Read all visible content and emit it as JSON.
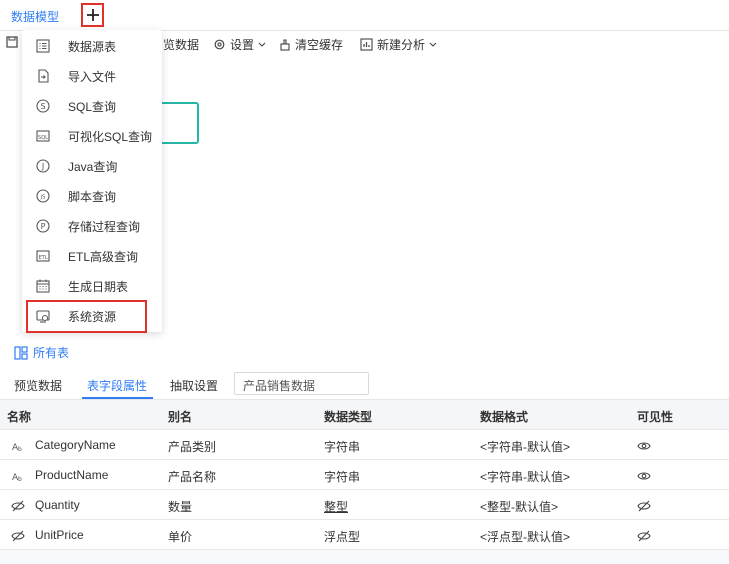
{
  "header": {
    "active_tab": "数据模型"
  },
  "toolbar": {
    "preview_label": "览数据",
    "settings_label": "设置",
    "clear_cache_label": "清空缓存",
    "new_analysis_label": "新建分析"
  },
  "dropdown": {
    "items": [
      {
        "label": "数据源表",
        "icon": "table-icon"
      },
      {
        "label": "导入文件",
        "icon": "file-import-icon"
      },
      {
        "label": "SQL查询",
        "icon": "sql-icon"
      },
      {
        "label": "可视化SQL查询",
        "icon": "visual-sql-icon"
      },
      {
        "label": "Java查询",
        "icon": "java-icon"
      },
      {
        "label": "脚本查询",
        "icon": "script-icon"
      },
      {
        "label": "存储过程查询",
        "icon": "procedure-icon"
      },
      {
        "label": "ETL高级查询",
        "icon": "etl-icon"
      },
      {
        "label": "生成日期表",
        "icon": "calendar-icon"
      },
      {
        "label": "系统资源",
        "icon": "system-resource-icon"
      }
    ]
  },
  "all_tables_label": "所有表",
  "panel": {
    "tabs": [
      "预览数据",
      "表字段属性",
      "抽取设置"
    ],
    "active_tab": "表字段属性",
    "table_name": "产品销售数据",
    "columns": [
      "名称",
      "别名",
      "数据类型",
      "数据格式",
      "可见性"
    ],
    "rows": [
      {
        "name": "CategoryName",
        "alias": "产品类别",
        "type": "字符串",
        "format": "<字符串-默认值>",
        "type_icon": "text-type-icon",
        "visible": true
      },
      {
        "name": "ProductName",
        "alias": "产品名称",
        "type": "字符串",
        "format": "<字符串-默认值>",
        "type_icon": "text-type-icon",
        "visible": true
      },
      {
        "name": "Quantity",
        "alias": "数量",
        "type": "整型",
        "format": "<整型-默认值>",
        "type_icon": "hidden-icon",
        "visible": false
      },
      {
        "name": "UnitPrice",
        "alias": "单价",
        "type": "浮点型",
        "format": "<浮点型-默认值>",
        "type_icon": "hidden-icon",
        "visible": false
      }
    ]
  },
  "colors": {
    "accent": "#2f7cf6",
    "highlight": "#e0322b",
    "node_border": "#25b7a6"
  }
}
